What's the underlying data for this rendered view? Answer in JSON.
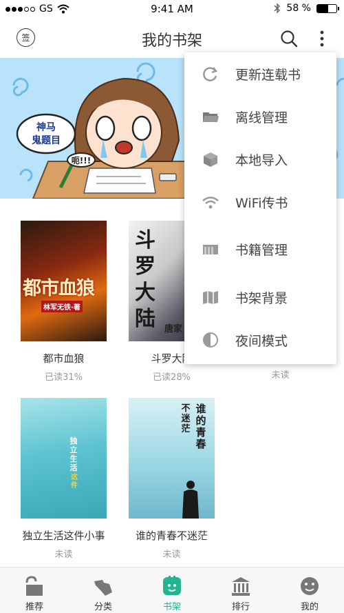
{
  "status_bar": {
    "carrier": "GS",
    "time": "9:41 AM",
    "battery": "58 %",
    "battery_level": 0.58
  },
  "nav": {
    "sign_label": "签",
    "title": "我的书架"
  },
  "banner": {
    "bubble_text_1": "神马",
    "bubble_text_2": "鬼题目",
    "exclaim_text": "呃!!!"
  },
  "books": [
    {
      "title": "都市血狼",
      "progress": "已读31%",
      "cover_text": "都市血狼",
      "cover_sub": "林军无铁·著"
    },
    {
      "title": "斗罗大陆",
      "progress": "已读28%",
      "cover_text": "斗罗大陆",
      "cover_sub": "唐家"
    },
    {
      "title": "",
      "progress": "未读"
    },
    {
      "title": "独立生活这件小事",
      "progress": "未读",
      "cover_text": "独立生活",
      "cover_sub": "这件"
    },
    {
      "title": "谁的青春不迷茫",
      "progress": "未读",
      "cover_text": "谁的青春",
      "cover_sub": "不迷茫"
    }
  ],
  "menu": {
    "items": [
      {
        "label": "更新连载书",
        "icon": "refresh-icon"
      },
      {
        "label": "离线管理",
        "icon": "folder-icon"
      },
      {
        "label": "本地导入",
        "icon": "box-icon"
      },
      {
        "label": "WiFi传书",
        "icon": "wifi-icon"
      },
      {
        "label": "书籍管理",
        "icon": "books-icon"
      },
      {
        "label": "书架背景",
        "icon": "map-icon"
      },
      {
        "label": "夜间模式",
        "icon": "half-circle-icon"
      }
    ]
  },
  "tabs": [
    {
      "label": "推荐",
      "icon": "lock-open-icon"
    },
    {
      "label": "分类",
      "icon": "hand-icon"
    },
    {
      "label": "书架",
      "icon": "bookshelf-icon",
      "active": true
    },
    {
      "label": "排行",
      "icon": "temple-icon"
    },
    {
      "label": "我的",
      "icon": "face-icon"
    }
  ],
  "colors": {
    "accent": "#22b58f",
    "banner_bg": "#b9e2fb"
  }
}
